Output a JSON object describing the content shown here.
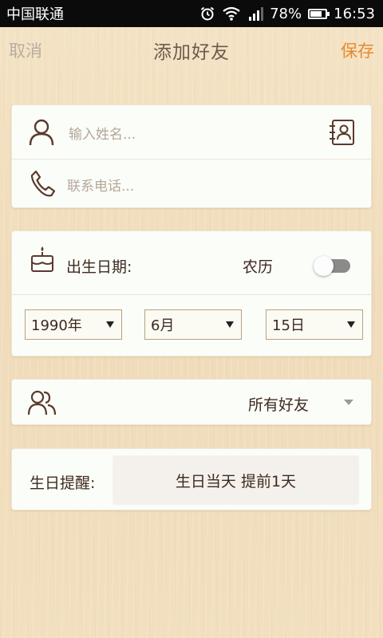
{
  "status_bar": {
    "carrier": "中国联通",
    "battery_percent": "78%",
    "battery_level": 0.78,
    "time": "16:53"
  },
  "header": {
    "cancel_label": "取消",
    "title": "添加好友",
    "save_label": "保存"
  },
  "contact_card": {
    "name_placeholder": "输入姓名...",
    "phone_placeholder": "联系电话..."
  },
  "birthday_card": {
    "label": "出生日期:",
    "lunar_label": "农历",
    "lunar_enabled": false,
    "year": "1990年",
    "month": "6月",
    "day": "15日"
  },
  "group_card": {
    "selected_group": "所有好友"
  },
  "reminder_card": {
    "label": "生日提醒:",
    "value": "生日当天 提前1天"
  },
  "colors": {
    "accent_save": "#e88a2f",
    "text_brown": "#4a2f22",
    "icon_brown": "#5a3a2c"
  }
}
